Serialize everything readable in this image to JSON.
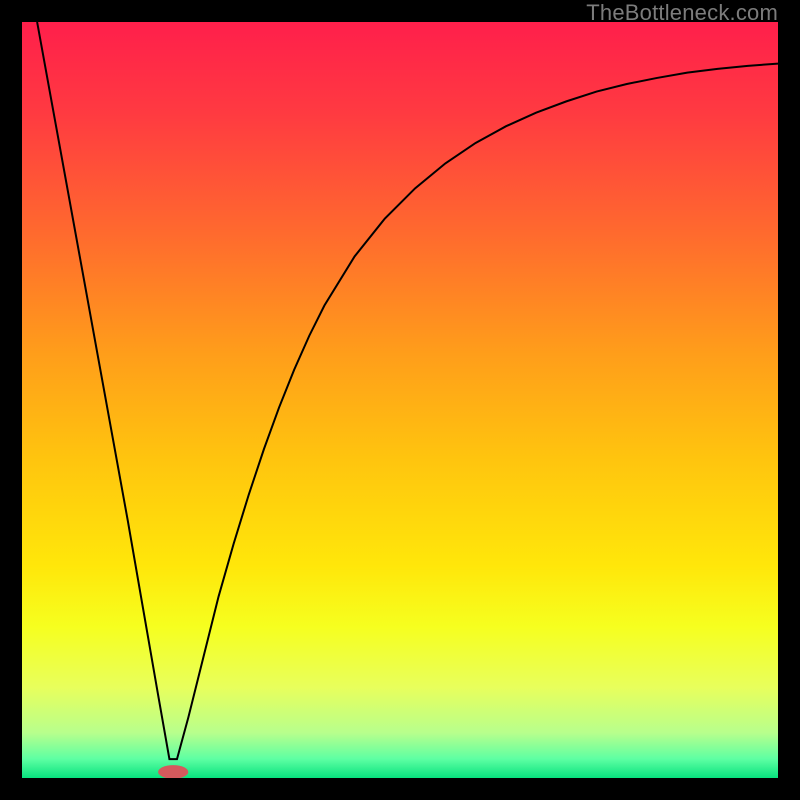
{
  "watermark": "TheBottleneck.com",
  "chart_data": {
    "type": "line",
    "title": "",
    "xlabel": "",
    "ylabel": "",
    "xlim": [
      0,
      100
    ],
    "ylim": [
      0,
      100
    ],
    "grid": false,
    "background_gradient": {
      "stops": [
        {
          "offset": 0.0,
          "color": "#ff1f4b"
        },
        {
          "offset": 0.12,
          "color": "#ff3a41"
        },
        {
          "offset": 0.28,
          "color": "#ff6a2e"
        },
        {
          "offset": 0.44,
          "color": "#ff9e1a"
        },
        {
          "offset": 0.58,
          "color": "#ffc50e"
        },
        {
          "offset": 0.72,
          "color": "#ffe70a"
        },
        {
          "offset": 0.8,
          "color": "#f6ff1f"
        },
        {
          "offset": 0.88,
          "color": "#e8ff5c"
        },
        {
          "offset": 0.94,
          "color": "#b8ff8c"
        },
        {
          "offset": 0.975,
          "color": "#5dffa3"
        },
        {
          "offset": 1.0,
          "color": "#08e27e"
        }
      ]
    },
    "series": [
      {
        "name": "bottleneck-curve",
        "color": "#000000",
        "stroke_width": 2,
        "x": [
          2,
          4,
          6,
          8,
          10,
          12,
          14,
          16,
          18,
          19.5,
          20.5,
          22,
          24,
          26,
          28,
          30,
          32,
          34,
          36,
          38,
          40,
          44,
          48,
          52,
          56,
          60,
          64,
          68,
          72,
          76,
          80,
          84,
          88,
          92,
          96,
          100
        ],
        "y": [
          100,
          89,
          78,
          67,
          56,
          45,
          34,
          22.5,
          11,
          2.5,
          2.5,
          8,
          16,
          24,
          31,
          37.5,
          43.5,
          49,
          54,
          58.5,
          62.5,
          69,
          74,
          78,
          81.3,
          84,
          86.2,
          88,
          89.5,
          90.8,
          91.8,
          92.6,
          93.3,
          93.8,
          94.2,
          94.5
        ]
      }
    ],
    "marker": {
      "name": "bottleneck-minimum",
      "x": 20,
      "y": 0.8,
      "rx": 2.0,
      "ry": 0.9,
      "fill": "#d45a5d"
    }
  }
}
